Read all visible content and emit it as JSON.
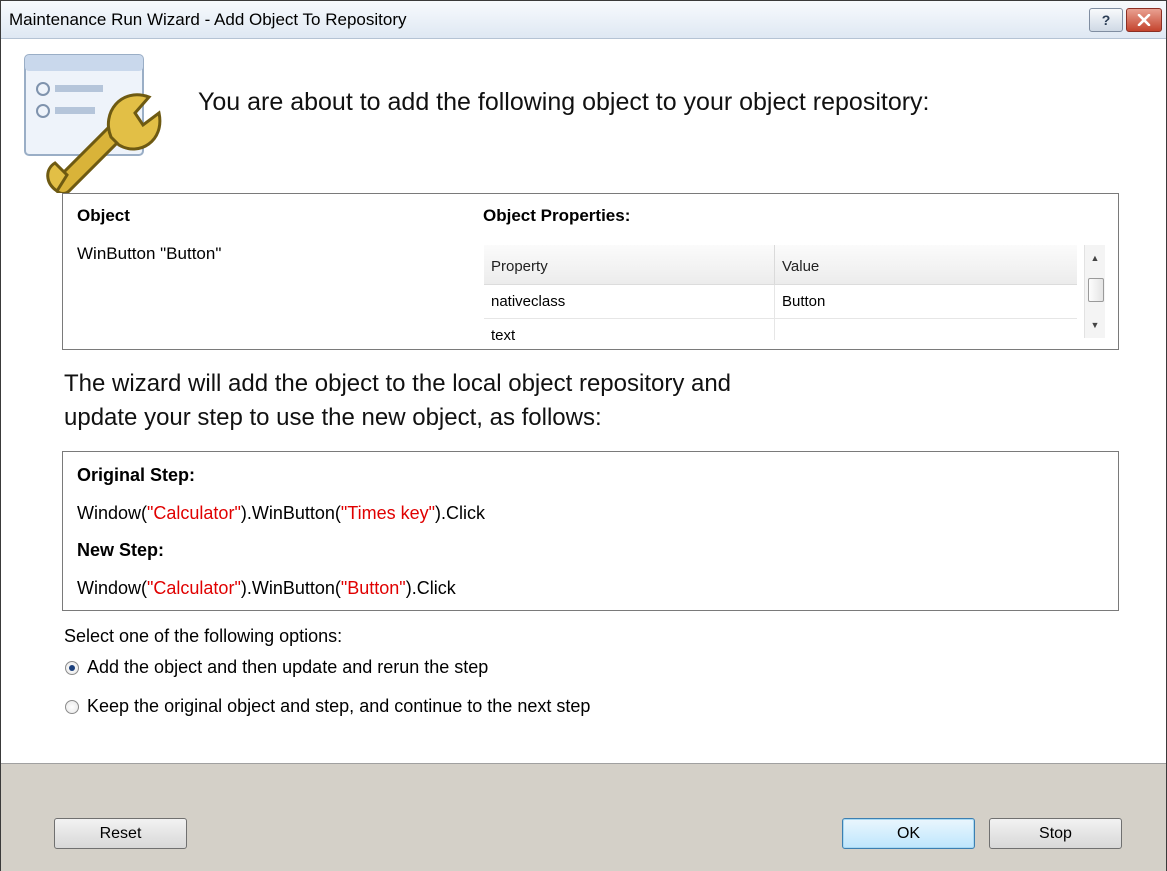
{
  "window": {
    "title": "Maintenance Run Wizard - Add Object To Repository",
    "help_glyph": "?",
    "close_icon": "close-icon"
  },
  "intro": "You are about to add the following object to your object repository:",
  "object_section": {
    "object_label": "Object",
    "object_value": "WinButton \"Button\"",
    "properties_label": "Object Properties:",
    "columns": [
      "Property",
      "Value"
    ],
    "rows": [
      {
        "property": "nativeclass",
        "value": "Button"
      },
      {
        "property": "text",
        "value": ""
      }
    ]
  },
  "explanation": {
    "line1": "The wizard will add the object to the local object repository and",
    "line2": "update your step to use the new object, as follows:"
  },
  "steps": {
    "original_label": "Original Step:",
    "original": {
      "prefix": "Window(",
      "window_arg": "\"Calculator\"",
      "middle": ").WinButton(",
      "button_arg": "\"Times key\"",
      "suffix": ").Click"
    },
    "new_label": "New Step:",
    "new": {
      "prefix": "Window(",
      "window_arg": "\"Calculator\"",
      "middle": ").WinButton(",
      "button_arg": "\"Button\"",
      "suffix": ").Click"
    },
    "string_color": "#e00000"
  },
  "options": {
    "prompt": "Select one of the following options:",
    "items": [
      {
        "label": "Add the object and then update and rerun the step",
        "selected": true
      },
      {
        "label": "Keep the original object and step, and continue to the next step",
        "selected": false
      }
    ]
  },
  "buttons": {
    "reset": "Reset",
    "ok": "OK",
    "stop": "Stop"
  }
}
